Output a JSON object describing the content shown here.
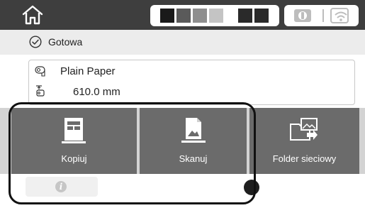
{
  "status": {
    "text": "Gotowa"
  },
  "paper": {
    "type": "Plain Paper",
    "length_value": "610.0",
    "length_unit": "mm"
  },
  "tiles": [
    {
      "label": "Kopiuj",
      "icon": "copy-icon"
    },
    {
      "label": "Skanuj",
      "icon": "scan-icon"
    },
    {
      "label": "Folder sieciowy",
      "icon": "network-folder-icon"
    }
  ],
  "icons": {
    "home": "home-icon",
    "status": "check-circle-icon",
    "paper_type": "paper-roll-icon",
    "paper_length": "paper-length-icon",
    "info": "info-icon",
    "network": "wifi-icon"
  },
  "colors": {
    "topbar": "#3e3e3e",
    "tile": "#6b6b6b",
    "ink": [
      "#1a1a1a",
      "#5a5a5a",
      "#8e8e8e",
      "#c4c4c4",
      "#2a2a2a",
      "#2a2a2a"
    ]
  }
}
